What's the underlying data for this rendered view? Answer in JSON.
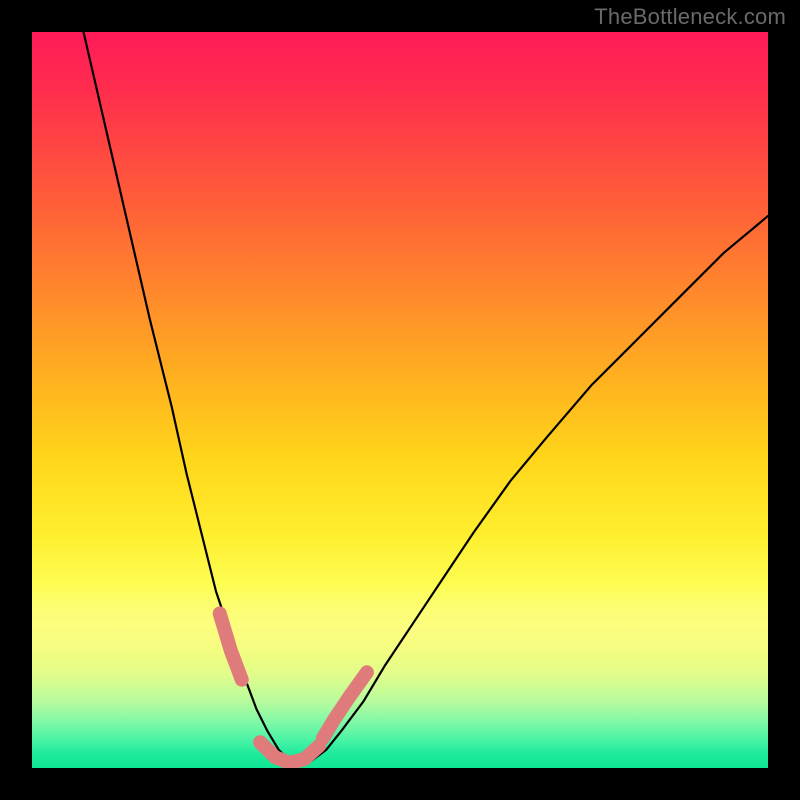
{
  "watermark": "TheBottleneck.com",
  "chart_data": {
    "type": "line",
    "title": "",
    "xlabel": "",
    "ylabel": "",
    "xlim": [
      0,
      100
    ],
    "ylim": [
      0,
      100
    ],
    "grid": false,
    "legend": false,
    "background_gradient_stops": [
      {
        "pos": 0,
        "color": "#ff1a58"
      },
      {
        "pos": 8,
        "color": "#ff2d4d"
      },
      {
        "pos": 22,
        "color": "#ff5a3a"
      },
      {
        "pos": 36,
        "color": "#ff8a2b"
      },
      {
        "pos": 48,
        "color": "#ffb41f"
      },
      {
        "pos": 58,
        "color": "#ffd61a"
      },
      {
        "pos": 68,
        "color": "#ffee2e"
      },
      {
        "pos": 75,
        "color": "#fdfd52"
      },
      {
        "pos": 82,
        "color": "#fafd76"
      },
      {
        "pos": 87,
        "color": "#e4fd8a"
      },
      {
        "pos": 91,
        "color": "#b7fb9d"
      },
      {
        "pos": 94,
        "color": "#7af7a6"
      },
      {
        "pos": 96.5,
        "color": "#43f2a4"
      },
      {
        "pos": 98,
        "color": "#1feb9c"
      },
      {
        "pos": 100,
        "color": "#0fe693"
      }
    ],
    "series": [
      {
        "name": "bottleneck-curve",
        "color": "#000000",
        "x": [
          7,
          10,
          13,
          16,
          19,
          21,
          23,
          25,
          27,
          29,
          30.5,
          32,
          33.5,
          35,
          36.5,
          38,
          40,
          42,
          45,
          48,
          52,
          56,
          60,
          65,
          70,
          76,
          82,
          88,
          94,
          100
        ],
        "y": [
          100,
          87,
          74,
          61,
          49,
          40,
          32,
          24,
          18,
          12,
          8,
          5,
          2.5,
          1,
          0.5,
          1,
          2.5,
          5,
          9,
          14,
          20,
          26,
          32,
          39,
          45,
          52,
          58,
          64,
          70,
          75
        ]
      }
    ],
    "highlight_segments": [
      {
        "name": "left-descent-pink",
        "color": "#e07b7b",
        "x": [
          25.5,
          27,
          28.5
        ],
        "y": [
          21,
          16,
          12
        ]
      },
      {
        "name": "valley-floor-pink",
        "color": "#e07b7b",
        "x": [
          31,
          33,
          35,
          37,
          39
        ],
        "y": [
          3.5,
          1.5,
          0.7,
          1.2,
          3
        ]
      },
      {
        "name": "right-ascent-pink",
        "color": "#e07b7b",
        "x": [
          39.5,
          41,
          43,
          45.5
        ],
        "y": [
          4,
          6.5,
          9.5,
          13
        ]
      }
    ],
    "annotations": []
  }
}
